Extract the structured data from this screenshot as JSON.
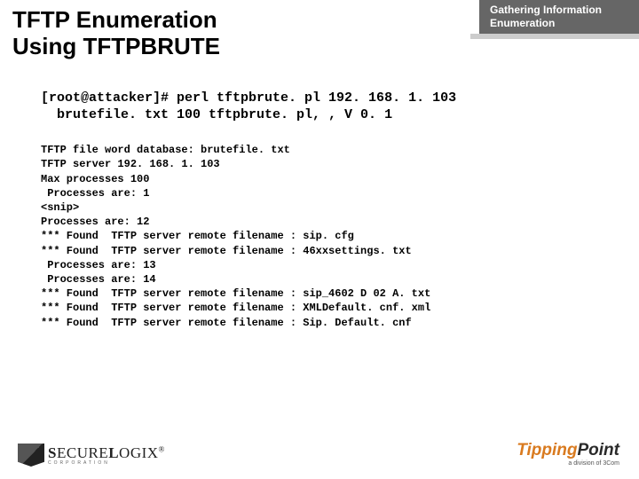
{
  "header": {
    "title_line1": "TFTP Enumeration",
    "title_line2": "Using TFTPBRUTE",
    "tab_line1": "Gathering Information",
    "tab_line2": "Enumeration"
  },
  "command": {
    "line1": "[root@attacker]# perl tftpbrute. pl 192. 168. 1. 103",
    "line2": "  brutefile. txt 100 tftpbrute. pl, , V 0. 1"
  },
  "output": {
    "l1": "TFTP file word database: brutefile. txt",
    "l2": "TFTP server 192. 168. 1. 103",
    "l3": "Max processes 100",
    "l4": " Processes are: 1",
    "l5": "<snip>",
    "l6": "Processes are: 12",
    "l7": "*** Found  TFTP server remote filename : sip. cfg",
    "l8": "*** Found  TFTP server remote filename : 46xxsettings. txt",
    "l9": " Processes are: 13",
    "l10": " Processes are: 14",
    "l11": "*** Found  TFTP server remote filename : sip_4602 D 02 A. txt",
    "l12": "*** Found  TFTP server remote filename : XMLDefault. cnf. xml",
    "l13": "*** Found  TFTP server remote filename : Sip. Default. cnf"
  },
  "footer": {
    "left_brand_a": "S",
    "left_brand_b": "ECURE",
    "left_brand_c": "L",
    "left_brand_d": "OGIX",
    "left_reg": "®",
    "left_corp": "CORPORATION",
    "right_a": "Tipping",
    "right_b": "Point",
    "right_sub": "a division of 3Com"
  }
}
